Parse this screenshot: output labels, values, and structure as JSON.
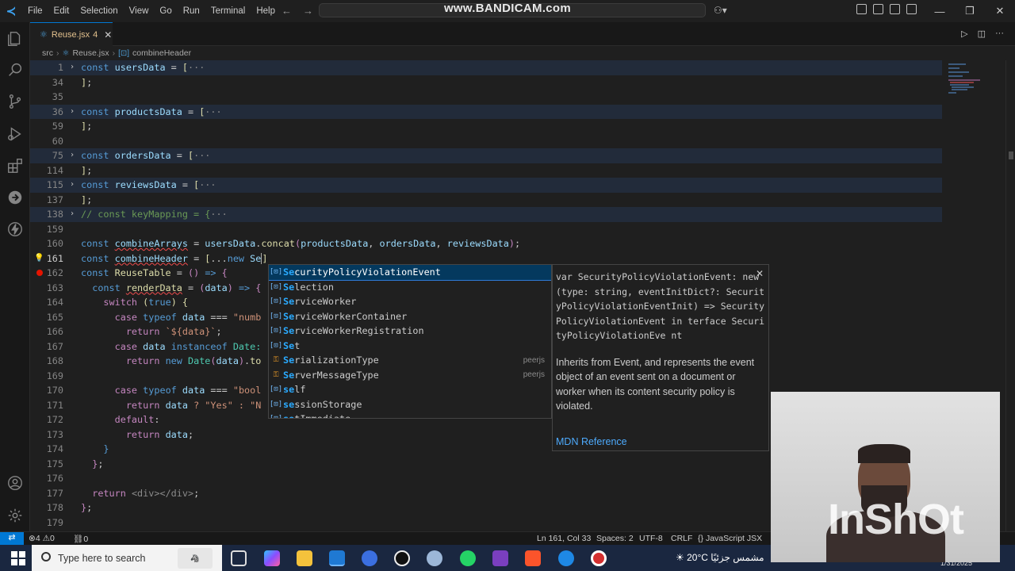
{
  "titlebar": {
    "menu": [
      "File",
      "Edit",
      "Selection",
      "View",
      "Go",
      "Run",
      "Terminal",
      "Help"
    ],
    "watermark": "www.BANDICAM.com"
  },
  "tab": {
    "filename": "Reuse.jsx",
    "problems": "4"
  },
  "breadcrumb": {
    "folder": "src",
    "file": "Reuse.jsx",
    "symbol": "combineHeader"
  },
  "editor": {
    "line_numbers": [
      "1",
      "34",
      "35",
      "36",
      "59",
      "60",
      "75",
      "114",
      "115",
      "137",
      "138",
      "159",
      "160",
      "161",
      "162",
      "163",
      "164",
      "165",
      "166",
      "167",
      "168",
      "169",
      "170",
      "171",
      "172",
      "173",
      "174",
      "175",
      "176",
      "177",
      "178",
      "179"
    ],
    "code": {
      "l1_name": "usersData",
      "l36_name": "productsData",
      "l75_name": "ordersData",
      "l115_name": "reviewsData",
      "l138_comment": "// const keyMapping = {",
      "l160": {
        "name": "combineArrays",
        "src": "usersData",
        "method": "concat",
        "a1": "productsData",
        "a2": "ordersData",
        "a3": "reviewsData"
      },
      "l161": {
        "name": "combineHeader",
        "typed": "Se"
      },
      "l162_name": "ReuseTable",
      "l163": {
        "name": "renderData",
        "param": "data"
      },
      "l165_str": "\"numb",
      "l166_tpl": "`${data}`",
      "l167_tail": "Date:",
      "l168_tail": "to",
      "l170_str": "\"bool",
      "l171_tail": "? \"Yes\" : \"N",
      "l177_jsx": "<div></div>"
    }
  },
  "suggest": {
    "items": [
      {
        "label": "SecurityPolicyViolationEvent",
        "kind": "var",
        "detail": ""
      },
      {
        "label": "Selection",
        "kind": "var",
        "detail": ""
      },
      {
        "label": "ServiceWorker",
        "kind": "var",
        "detail": ""
      },
      {
        "label": "ServiceWorkerContainer",
        "kind": "var",
        "detail": ""
      },
      {
        "label": "ServiceWorkerRegistration",
        "kind": "var",
        "detail": ""
      },
      {
        "label": "Set",
        "kind": "var",
        "detail": ""
      },
      {
        "label": "SerializationType",
        "kind": "type",
        "detail": "peerjs"
      },
      {
        "label": "ServerMessageType",
        "kind": "type",
        "detail": "peerjs"
      },
      {
        "label": "self",
        "kind": "var",
        "detail": ""
      },
      {
        "label": "sessionStorage",
        "kind": "var",
        "detail": ""
      },
      {
        "label": "setImmediate",
        "kind": "var",
        "detail": ""
      }
    ],
    "docs": {
      "signature": "var SecurityPolicyViolationEvent: new (type: string, eventInitDict?: SecurityPolicyViolationEventInit) => SecurityPolicyViolationEvent in terface SecurityPolicyViolationEve nt",
      "description": "Inherits from Event, and represents the event object of an event sent on a document or worker when its content security policy is violated.",
      "link": "MDN Reference"
    }
  },
  "statusbar": {
    "errors": "4",
    "warnings": "0",
    "ports": "0",
    "position": "Ln 161, Col 33",
    "spaces": "Spaces: 2",
    "encoding": "UTF-8",
    "eol": "CRLF",
    "language": "JavaScript JSX"
  },
  "taskbar": {
    "search_placeholder": "Type here to search",
    "temperature": "20°C",
    "weather_text": "مشمس جزئيًا",
    "date": "1/31/2025"
  },
  "webcam": {
    "brand": "InShOt"
  },
  "colors": {
    "accent": "#0078d4",
    "error": "#f14c4c",
    "selection": "#04395e"
  },
  "icons": [
    "explorer-icon",
    "search-icon",
    "source-control-icon",
    "run-debug-icon",
    "extensions-icon",
    "remote-explorer-icon",
    "thunder-icon",
    "account-icon",
    "settings-icon"
  ]
}
